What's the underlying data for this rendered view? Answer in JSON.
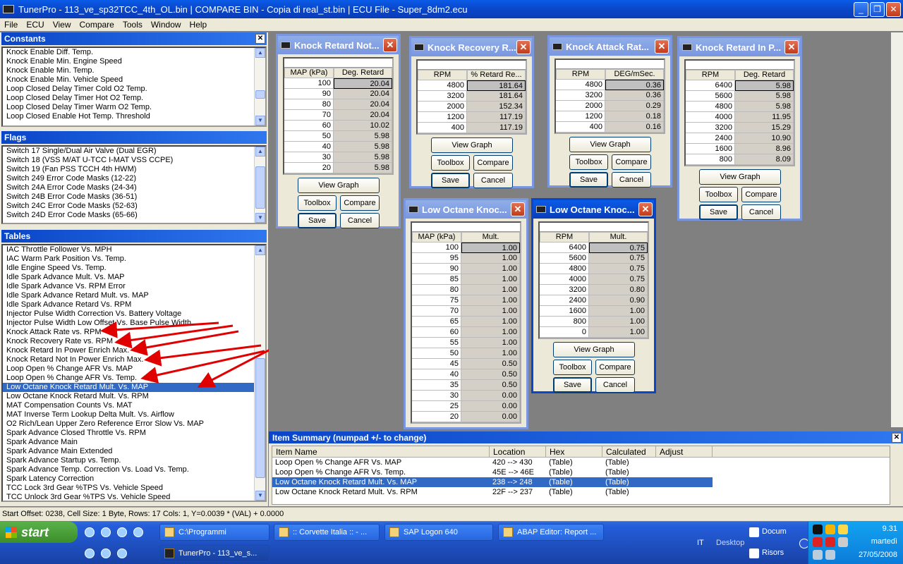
{
  "window": {
    "title": "TunerPro - 113_ve_sp32TCC_4th_OL.bin | COMPARE BIN - Copia di real_st.bin | ECU File - Super_8dm2.ecu"
  },
  "menu": [
    "File",
    "ECU",
    "View",
    "Compare",
    "Tools",
    "Window",
    "Help"
  ],
  "constants": {
    "title": "Constants",
    "items": [
      "Knock Enable Diff. Temp.",
      "Knock Enable Min. Engine Speed",
      "Knock Enable Min. Temp.",
      "Knock Enable Min. Vehicle Speed",
      "Loop Closed Delay Timer Cold O2 Temp.",
      "Loop Closed Delay Timer Hot O2 Temp.",
      "Loop Closed Delay Timer Warm O2 Temp.",
      "Loop Closed Enable Hot Temp. Threshold"
    ]
  },
  "flags": {
    "title": "Flags",
    "items": [
      "Switch 17 Single/Dual Air Valve (Dual EGR)",
      "Switch 18 (VSS M/AT U-TCC I-MAT VSS CCPE)",
      "Switch 19 (Fan PSS TCCH 4th HWM)",
      "Switch 249 Error Code Masks (12-22)",
      "Switch 24A Error Code Masks (24-34)",
      "Switch 24B Error Code Masks (36-51)",
      "Switch 24C Error Code Masks (52-63)",
      "Switch 24D Error Code Masks (65-66)"
    ]
  },
  "tables": {
    "title": "Tables",
    "items": [
      "IAC Throttle Follower Vs. MPH",
      "IAC Warm Park Position Vs. Temp.",
      "Idle Engine Speed Vs. Temp.",
      "Idle Spark Advance Mult. Vs. MAP",
      "Idle Spark Advance Vs. RPM Error",
      "Idle Spark Advance Retard Mult. vs. MAP",
      "Idle Spark Advance Retard Vs. RPM",
      "Injector Pulse Width Correction Vs. Battery Voltage",
      "Injector Pulse Width Low Offset Vs. Base Pulse Width",
      "Knock Attack Rate vs. RPM",
      "Knock Recovery Rate vs. RPM",
      "Knock Retard In Power Enrich Max.",
      "Knock Retard Not In Power Enrich Max.",
      "Loop Open % Change AFR Vs. MAP",
      "Loop Open % Change AFR Vs. Temp.",
      "Low Octane Knock Retard Mult. Vs. MAP",
      "Low Octane Knock Retard Mult. Vs. RPM",
      "MAT Compensation Counts Vs. MAT",
      "MAT Inverse Term Lookup Delta Mult. Vs. Airflow",
      "O2 Rich/Lean Upper Zero Reference Error Slow Vs. MAP",
      "Spark Advance Closed Throttle Vs. RPM",
      "Spark Advance Main",
      "Spark Advance Main Extended",
      "Spark Advance Startup vs. Temp.",
      "Spark Advance Temp. Correction Vs. Load Vs. Temp.",
      "Spark Latency Correction",
      "TCC Lock 3rd Gear %TPS Vs. Vehicle Speed",
      "TCC Unlock 3rd Gear %TPS Vs. Vehicle Speed"
    ],
    "selected_index": 15
  },
  "buttons": {
    "view_graph": "View Graph",
    "toolbox": "Toolbox",
    "compare": "Compare",
    "save": "Save",
    "cancel": "Cancel"
  },
  "windows": [
    {
      "title": "Knock Retard Not...",
      "col1": "MAP (kPa)",
      "col2": "Deg. Retard",
      "rows": [
        [
          "100",
          "20.04"
        ],
        [
          "90",
          "20.04"
        ],
        [
          "80",
          "20.04"
        ],
        [
          "70",
          "20.04"
        ],
        [
          "60",
          "10.02"
        ],
        [
          "50",
          "5.98"
        ],
        [
          "40",
          "5.98"
        ],
        [
          "30",
          "5.98"
        ],
        [
          "20",
          "5.98"
        ]
      ]
    },
    {
      "title": "Knock Recovery R...",
      "col1": "RPM",
      "col2": "% Retard Re...",
      "rows": [
        [
          "4800",
          "181.64"
        ],
        [
          "3200",
          "181.64"
        ],
        [
          "2000",
          "152.34"
        ],
        [
          "1200",
          "117.19"
        ],
        [
          "400",
          "117.19"
        ]
      ]
    },
    {
      "title": "Knock Attack Rat...",
      "col1": "RPM",
      "col2": "DEG/mSec.",
      "rows": [
        [
          "4800",
          "0.36"
        ],
        [
          "3200",
          "0.36"
        ],
        [
          "2000",
          "0.29"
        ],
        [
          "1200",
          "0.18"
        ],
        [
          "400",
          "0.16"
        ]
      ]
    },
    {
      "title": "Knock Retard In P...",
      "col1": "RPM",
      "col2": "Deg. Retard",
      "rows": [
        [
          "6400",
          "5.98"
        ],
        [
          "5600",
          "5.98"
        ],
        [
          "4800",
          "5.98"
        ],
        [
          "4000",
          "11.95"
        ],
        [
          "3200",
          "15.29"
        ],
        [
          "2400",
          "10.90"
        ],
        [
          "1600",
          "8.96"
        ],
        [
          "800",
          "8.09"
        ]
      ]
    },
    {
      "title": "Low Octane Knoc...",
      "col1": "MAP (kPa)",
      "col2": "Mult.",
      "rows": [
        [
          "100",
          "1.00"
        ],
        [
          "95",
          "1.00"
        ],
        [
          "90",
          "1.00"
        ],
        [
          "85",
          "1.00"
        ],
        [
          "80",
          "1.00"
        ],
        [
          "75",
          "1.00"
        ],
        [
          "70",
          "1.00"
        ],
        [
          "65",
          "1.00"
        ],
        [
          "60",
          "1.00"
        ],
        [
          "55",
          "1.00"
        ],
        [
          "50",
          "1.00"
        ],
        [
          "45",
          "0.50"
        ],
        [
          "40",
          "0.50"
        ],
        [
          "35",
          "0.50"
        ],
        [
          "30",
          "0.00"
        ],
        [
          "25",
          "0.00"
        ],
        [
          "20",
          "0.00"
        ]
      ]
    },
    {
      "title": "Low Octane Knoc...",
      "col1": "RPM",
      "col2": "Mult.",
      "rows": [
        [
          "6400",
          "0.75"
        ],
        [
          "5600",
          "0.75"
        ],
        [
          "4800",
          "0.75"
        ],
        [
          "4000",
          "0.75"
        ],
        [
          "3200",
          "0.80"
        ],
        [
          "2400",
          "0.90"
        ],
        [
          "1600",
          "1.00"
        ],
        [
          "800",
          "1.00"
        ],
        [
          "0",
          "1.00"
        ]
      ]
    }
  ],
  "summary": {
    "title": "Item Summary (numpad +/- to change)",
    "columns": [
      "Item Name",
      "Location",
      "Hex",
      "Calculated",
      "Adjust"
    ],
    "rows": [
      [
        "Loop Open % Change AFR Vs. MAP",
        "420 --> 430",
        "(Table)",
        "(Table)",
        ""
      ],
      [
        "Loop Open % Change AFR Vs. Temp.",
        "45E --> 46E",
        "(Table)",
        "(Table)",
        ""
      ],
      [
        "Low Octane Knock Retard Mult. Vs. MAP",
        "238 --> 248",
        "(Table)",
        "(Table)",
        ""
      ],
      [
        "Low Octane Knock Retard Mult. Vs. RPM",
        "22F --> 237",
        "(Table)",
        "(Table)",
        ""
      ]
    ],
    "selected_index": 2
  },
  "status": "Start Offset: 0238,  Cell Size: 1 Byte,   Rows: 17 Cols: 1,    Y=0.0039 * (VAL) + 0.0000",
  "taskbar": {
    "start": "start",
    "tasks_top": [
      "C:\\Programmi",
      ":: Corvette Italia :: - ...",
      "SAP Logon 640",
      "ABAP Editor: Report ..."
    ],
    "tasks_bottom": [
      "TunerPro - 113_ve_s..."
    ],
    "lang": "IT",
    "desktop": "Desktop",
    "docu": "Docum",
    "risors": "Risors",
    "time": "9.31",
    "day": "martedì",
    "date": "27/05/2008"
  }
}
